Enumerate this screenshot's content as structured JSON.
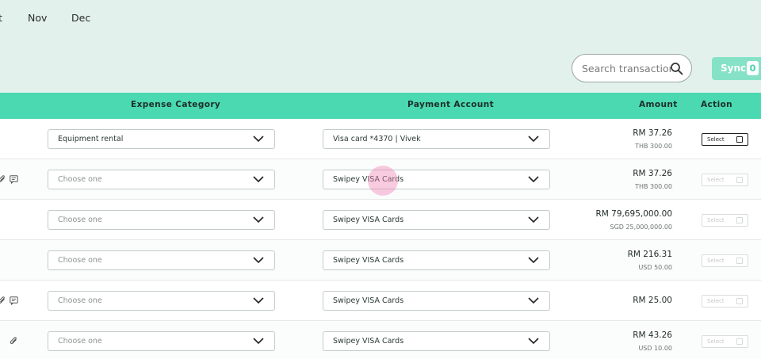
{
  "months": [
    "t",
    "Nov",
    "Dec"
  ],
  "search": {
    "placeholder": "Search transactions"
  },
  "sync": {
    "label": "Sync",
    "count": "0"
  },
  "table": {
    "headers": {
      "expense_category": "Expense Category",
      "payment_account": "Payment Account",
      "amount": "Amount",
      "action": "Action"
    },
    "rows": [
      {
        "expense_category": "Equipment rental",
        "payment_account": "Visa card *4370 | Vivek",
        "amount": "RM 37.26",
        "amount_original": "THB 300.00",
        "action": "Select"
      },
      {
        "expense_category": "Choose one",
        "payment_account": "Swipey VISA Cards",
        "amount": "RM 37.26",
        "amount_original": "THB 300.00",
        "action": "Select"
      },
      {
        "expense_category": "Choose one",
        "payment_account": "Swipey VISA Cards",
        "amount": "RM 79,695,000.00",
        "amount_original": "SGD 25,000,000.00",
        "action": "Select"
      },
      {
        "expense_category": "Choose one",
        "payment_account": "Swipey VISA Cards",
        "amount": "RM 216.31",
        "amount_original": "USD 50.00",
        "action": "Select"
      },
      {
        "expense_category": "Choose one",
        "payment_account": "Swipey VISA Cards",
        "amount": "RM 25.00",
        "amount_original": "",
        "action": "Select"
      },
      {
        "expense_category": "Choose one",
        "payment_account": "Swipey VISA Cards",
        "amount": "RM 43.26",
        "amount_original": "USD 10.00",
        "action": "Select"
      }
    ]
  },
  "colors": {
    "top_background": "#e2f1ec",
    "header_background": "#4ad9b0",
    "sync_button": "#86e2c6"
  },
  "icons": [
    "search-icon",
    "chevron-down-icon",
    "attachment-icon",
    "comment-icon"
  ]
}
